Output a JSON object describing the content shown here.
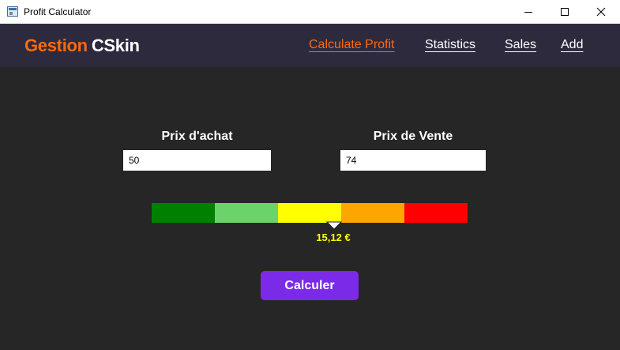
{
  "window": {
    "title": "Profit Calculator"
  },
  "brand": {
    "part1": "Gestion",
    "part2": "CSkin",
    "accent_color": "#ff6a0a"
  },
  "nav": {
    "items": [
      {
        "label": "Calculate Profit",
        "active": true
      },
      {
        "label": "Statistics",
        "active": false
      },
      {
        "label": "Sales",
        "active": false
      },
      {
        "label": "Add",
        "active": false
      }
    ]
  },
  "form": {
    "achat_label": "Prix d'achat",
    "achat_value": "50",
    "vente_label": "Prix de Vente",
    "vente_value": "74"
  },
  "gauge": {
    "segments": [
      "#008000",
      "#6ad46a",
      "#ffff00",
      "#ffa500",
      "#ff0000"
    ],
    "value_text": "15,12 €",
    "value_color": "#ffff00"
  },
  "calculate_button": {
    "label": "Calculer",
    "color": "#7b2ae8"
  }
}
